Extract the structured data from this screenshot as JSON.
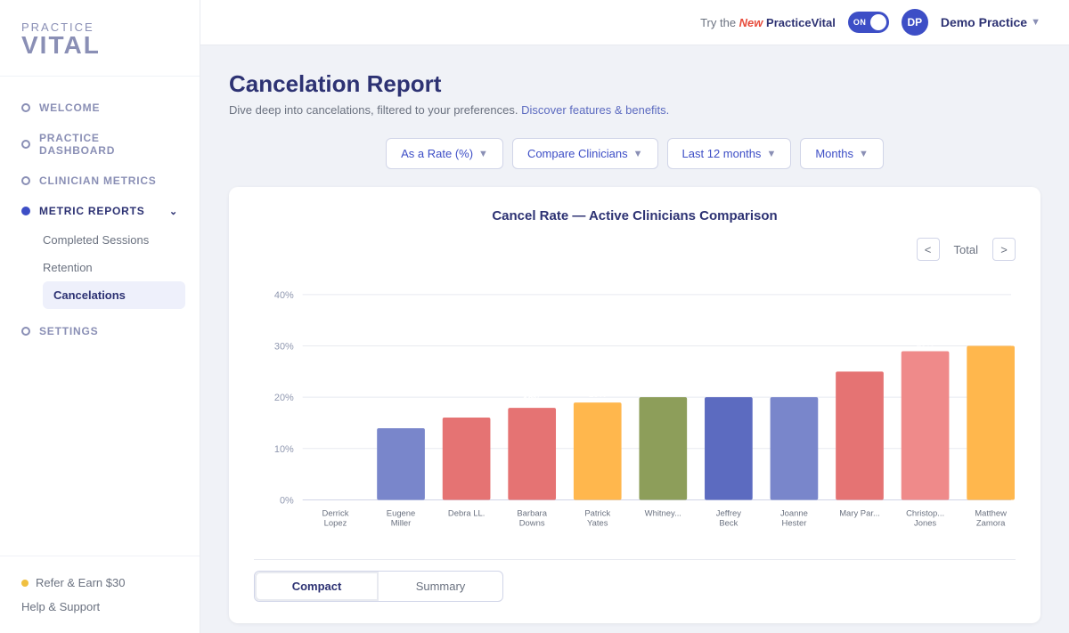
{
  "topbar": {
    "try_new_prefix": "Try the ",
    "try_new_highlight": "New",
    "try_new_suffix": " PracticeVital",
    "toggle_label": "ON",
    "user_initials": "DP",
    "practice_name": "Demo Practice"
  },
  "sidebar": {
    "logo_top": "practice",
    "logo_bottom": "vital",
    "nav_items": [
      {
        "id": "welcome",
        "label": "Welcome",
        "active": false
      },
      {
        "id": "practice-dashboard",
        "label": "Practice Dashboard",
        "active": false
      },
      {
        "id": "clinician-metrics",
        "label": "Clinician Metrics",
        "active": false
      },
      {
        "id": "metric-reports",
        "label": "Metric Reports",
        "active": true,
        "expanded": true
      }
    ],
    "sub_items": [
      {
        "id": "completed-sessions",
        "label": "Completed Sessions",
        "active": false
      },
      {
        "id": "retention",
        "label": "Retention",
        "active": false
      },
      {
        "id": "cancelations",
        "label": "Cancelations",
        "active": true
      }
    ],
    "settings": {
      "label": "Settings"
    },
    "bottom_links": [
      {
        "id": "refer",
        "label": "Refer & Earn $30"
      },
      {
        "id": "help",
        "label": "Help & Support"
      }
    ]
  },
  "page": {
    "title": "Cancelation Report",
    "subtitle": "Dive deep into cancelations, filtered to your preferences.",
    "subtitle_link": "Discover features & benefits."
  },
  "filters": [
    {
      "id": "display-type",
      "label": "As a Rate (%)"
    },
    {
      "id": "compare",
      "label": "Compare Clinicians"
    },
    {
      "id": "period",
      "label": "Last 12 months"
    },
    {
      "id": "granularity",
      "label": "Months"
    }
  ],
  "chart": {
    "title": "Cancel Rate — Active Clinicians Comparison",
    "nav_prev": "<",
    "nav_next": ">",
    "nav_label": "Total",
    "y_labels": [
      "40%",
      "30%",
      "20%",
      "10%",
      "0%"
    ],
    "bars": [
      {
        "name": "Derrick\nLopez",
        "value": 0,
        "label": "",
        "color": "#e8eaf0"
      },
      {
        "name": "Eugene\nMiller",
        "value": 14,
        "label": "14%",
        "color": "#7986cb"
      },
      {
        "name": "Debra LL.",
        "value": 16,
        "label": "16%",
        "color": "#e57373"
      },
      {
        "name": "Barbara\nDowns",
        "value": 18,
        "label": "18%",
        "color": "#e57373"
      },
      {
        "name": "Patrick\nYates",
        "value": 19,
        "label": "19%",
        "color": "#ffb74d"
      },
      {
        "name": "Whitney...",
        "value": 20,
        "label": "20%",
        "color": "#8d9e5a"
      },
      {
        "name": "Jeffrey\nBeck",
        "value": 20,
        "label": "20%",
        "color": "#5c6bc0"
      },
      {
        "name": "Joanne\nHester",
        "value": 20,
        "label": "20%",
        "color": "#7986cb"
      },
      {
        "name": "Mary Par...",
        "value": 25,
        "label": "25%",
        "color": "#e57373"
      },
      {
        "name": "Christop...\nJones",
        "value": 29,
        "label": "29%",
        "color": "#ef7373"
      },
      {
        "name": "Matthew\nZamora",
        "value": 30,
        "label": "30%",
        "color": "#ffb74d"
      }
    ]
  },
  "bottom_tabs": [
    {
      "id": "compact",
      "label": "Compact",
      "active": true
    },
    {
      "id": "summary",
      "label": "Summary",
      "active": false
    }
  ]
}
